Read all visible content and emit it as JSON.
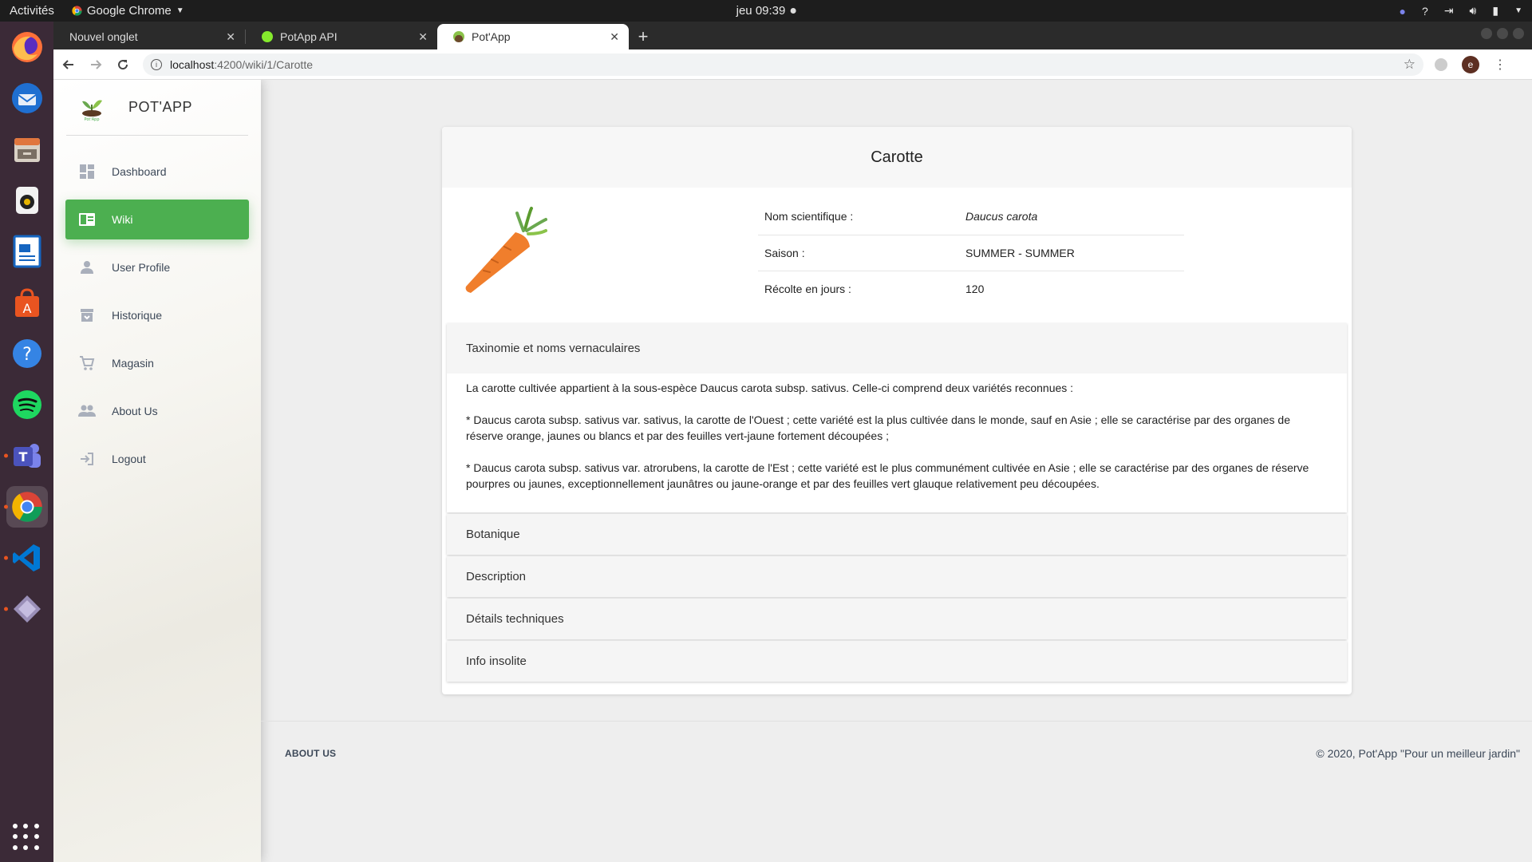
{
  "os": {
    "activities": "Activités",
    "app_menu": "Google Chrome",
    "clock": "jeu 09:39"
  },
  "browser": {
    "tabs": [
      {
        "title": "Nouvel onglet",
        "active": false
      },
      {
        "title": "PotApp API",
        "active": false
      },
      {
        "title": "Pot'App",
        "active": true
      }
    ],
    "url_host": "localhost",
    "url_path": ":4200/wiki/1/Carotte",
    "profile_initial": "e"
  },
  "sidebar": {
    "brand": "POT'APP",
    "items": [
      {
        "label": "Dashboard",
        "icon": "dashboard-icon"
      },
      {
        "label": "Wiki",
        "icon": "wiki-icon",
        "active": true
      },
      {
        "label": "User Profile",
        "icon": "person-icon"
      },
      {
        "label": "Historique",
        "icon": "archive-icon"
      },
      {
        "label": "Magasin",
        "icon": "cart-icon"
      },
      {
        "label": "About Us",
        "icon": "group-icon"
      },
      {
        "label": "Logout",
        "icon": "logout-icon"
      }
    ]
  },
  "plant": {
    "title": "Carotte",
    "facts": [
      {
        "label": "Nom scientifique :",
        "value": "Daucus carota"
      },
      {
        "label": "Saison :",
        "value": "SUMMER - SUMMER"
      },
      {
        "label": "Récolte en jours :",
        "value": "120"
      }
    ],
    "sections": [
      {
        "title": "Taxinomie et noms vernaculaires",
        "expanded": true,
        "paragraphs": [
          "La carotte cultivée appartient à la sous-espèce Daucus carota subsp. sativus. Celle-ci comprend deux variétés reconnues :",
          "* Daucus carota subsp. sativus var. sativus, la carotte de l'Ouest ; cette variété est la plus cultivée dans le monde, sauf en Asie ; elle se caractérise par des organes de réserve orange, jaunes ou blancs et par des feuilles vert-jaune fortement découpées ;",
          "* Daucus carota subsp. sativus var. atrorubens, la carotte de l'Est ; cette variété est le plus communément cultivée en Asie ; elle se caractérise par des organes de réserve pourpres ou jaunes, exceptionnellement jaunâtres ou jaune-orange et par des feuilles vert glauque relativement peu découpées."
        ]
      },
      {
        "title": "Botanique",
        "expanded": false
      },
      {
        "title": "Description",
        "expanded": false
      },
      {
        "title": "Détails techniques",
        "expanded": false
      },
      {
        "title": "Info insolite",
        "expanded": false
      }
    ]
  },
  "footer": {
    "about": "ABOUT US",
    "copyright": "© 2020, Pot'App \"Pour un meilleur jardin\""
  },
  "colors": {
    "accent": "#4caf50",
    "dock": "#3b2a37"
  }
}
